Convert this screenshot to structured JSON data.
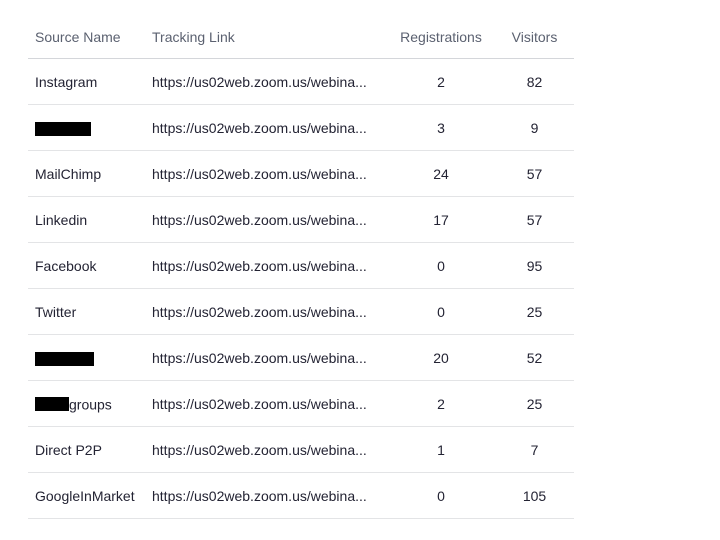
{
  "table": {
    "headers": {
      "source_name": "Source Name",
      "tracking_link": "Tracking Link",
      "registrations": "Registrations",
      "visitors": "Visitors"
    },
    "rows": [
      {
        "source_name": "Instagram",
        "source_redacted": false,
        "tracking_link": "https://us02web.zoom.us/webina...",
        "registrations": "2",
        "visitors": "82"
      },
      {
        "source_name": "",
        "source_redacted": true,
        "tracking_link": "https://us02web.zoom.us/webina...",
        "registrations": "3",
        "visitors": "9"
      },
      {
        "source_name": "MailChimp",
        "source_redacted": false,
        "tracking_link": "https://us02web.zoom.us/webina...",
        "registrations": "24",
        "visitors": "57"
      },
      {
        "source_name": "Linkedin",
        "source_redacted": false,
        "tracking_link": "https://us02web.zoom.us/webina...",
        "registrations": "17",
        "visitors": "57"
      },
      {
        "source_name": "Facebook",
        "source_redacted": false,
        "tracking_link": "https://us02web.zoom.us/webina...",
        "registrations": "0",
        "visitors": "95"
      },
      {
        "source_name": "Twitter",
        "source_redacted": false,
        "tracking_link": "https://us02web.zoom.us/webina...",
        "registrations": "0",
        "visitors": "25"
      },
      {
        "source_name": "",
        "source_redacted": true,
        "tracking_link": "https://us02web.zoom.us/webina...",
        "registrations": "20",
        "visitors": "52"
      },
      {
        "source_name": "groups",
        "source_redacted": true,
        "tracking_link": "https://us02web.zoom.us/webina...",
        "registrations": "2",
        "visitors": "25"
      },
      {
        "source_name": "Direct P2P",
        "source_redacted": false,
        "tracking_link": "https://us02web.zoom.us/webina...",
        "registrations": "1",
        "visitors": "7"
      },
      {
        "source_name": "GoogleInMarket",
        "source_redacted": false,
        "tracking_link": "https://us02web.zoom.us/webina...",
        "registrations": "0",
        "visitors": "105"
      }
    ]
  },
  "colors": {
    "header_text": "#5b6170",
    "body_text": "#232333",
    "divider": "#e3e4e6",
    "redaction": "#000000"
  }
}
